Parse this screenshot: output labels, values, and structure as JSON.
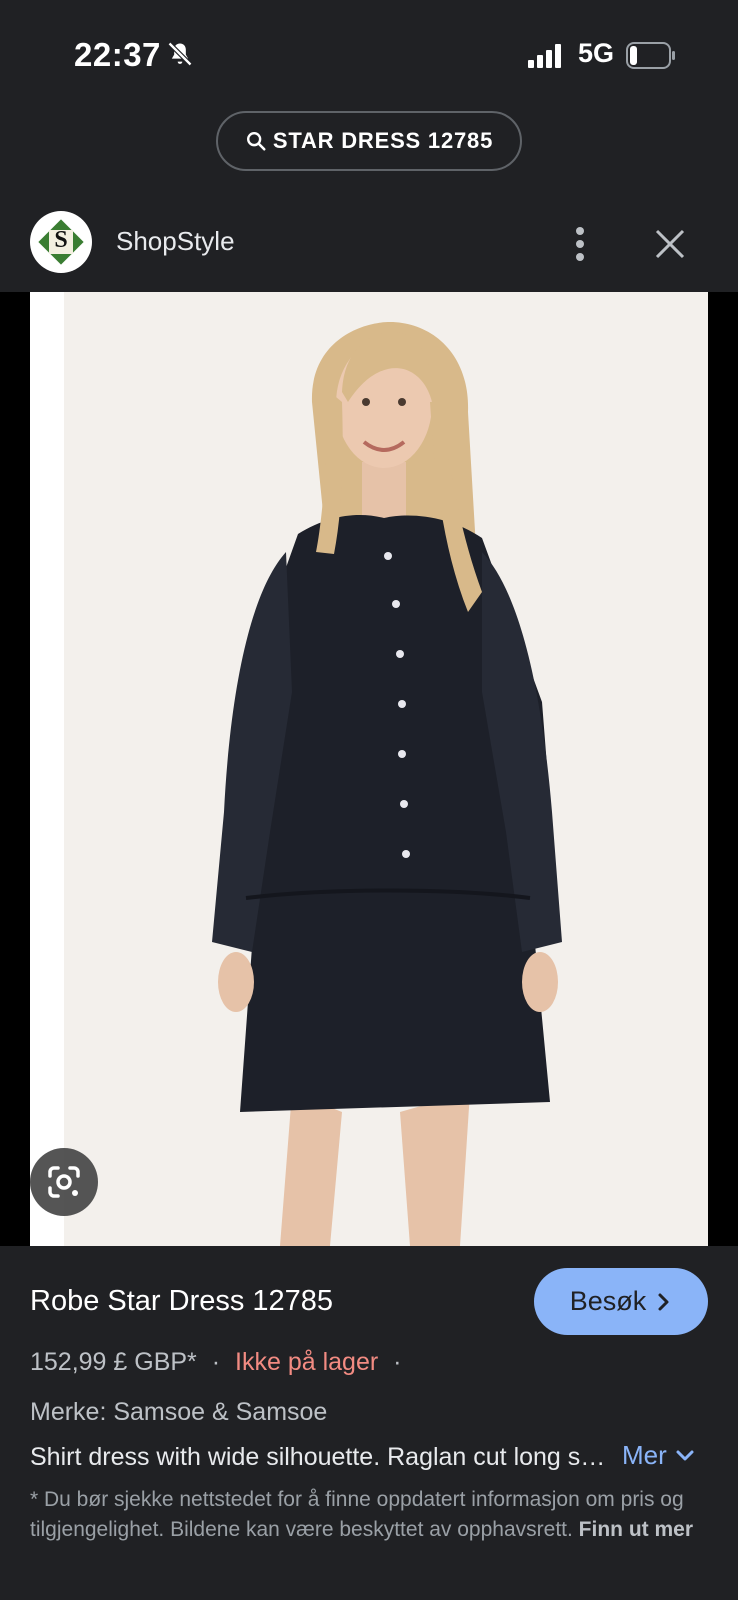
{
  "status_bar": {
    "time": "22:37",
    "network": "5G"
  },
  "search": {
    "query": "STAR DRESS 12785"
  },
  "source": {
    "name": "ShopStyle",
    "logo_letter": "S"
  },
  "product": {
    "title": "Robe Star Dress 12785",
    "visit_label": "Besøk",
    "price": "152,99 £ GBP*",
    "separator": "·",
    "stock_status": "Ikke på lager",
    "brand": "Merke: Samsoe & Samsoe",
    "description": "Shirt dress with wide silhouette. Raglan cut long sleeves with gathered cuffs.",
    "more_label": "Mer",
    "disclaimer": "* Du bør sjekke nettstedet for å finne oppdatert informasjon om pris og tilgjengelighet. Bildene kan være beskyttet av opphavsrett.",
    "learn_more": "Finn ut mer"
  },
  "colors": {
    "background": "#202124",
    "accent": "#8ab4f8",
    "stock_red": "#f28b82"
  }
}
